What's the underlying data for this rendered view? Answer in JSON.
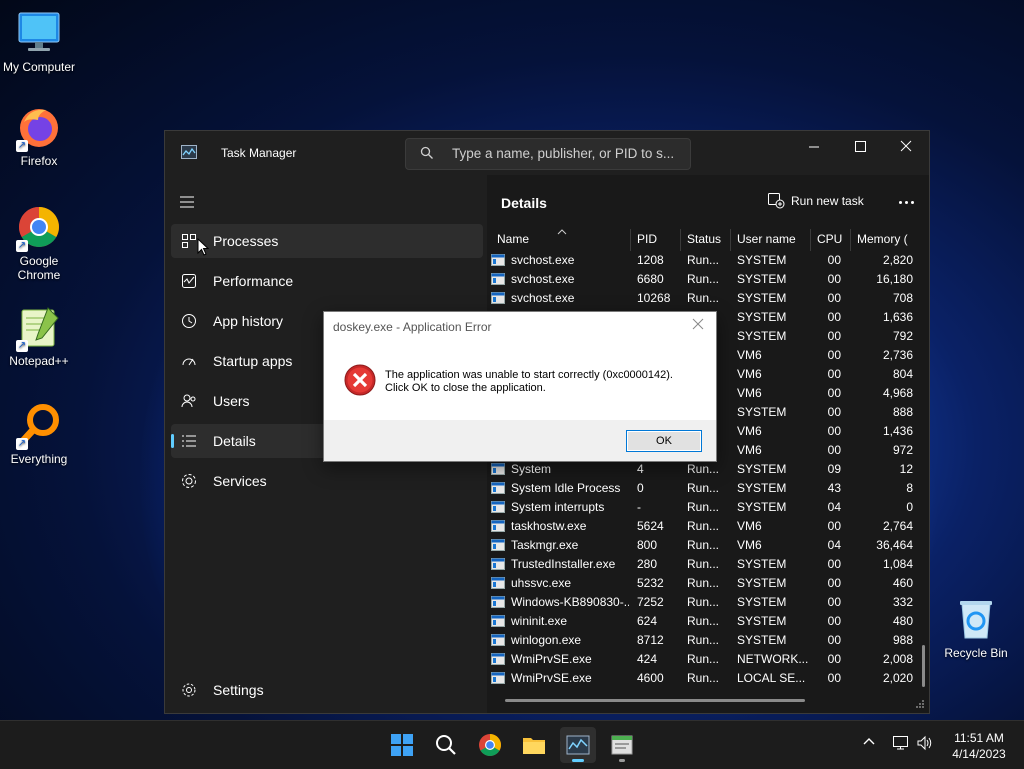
{
  "desktop": {
    "icons": [
      {
        "label": "My Computer"
      },
      {
        "label": "Firefox"
      },
      {
        "label": "Google Chrome"
      },
      {
        "label": "Notepad++"
      },
      {
        "label": "Everything"
      },
      {
        "label": "Recycle Bin"
      }
    ]
  },
  "task_manager": {
    "title": "Task Manager",
    "search_placeholder": "Type a name, publisher, or PID to s...",
    "nav": [
      {
        "label": "Processes",
        "icon": "processes-icon"
      },
      {
        "label": "Performance",
        "icon": "performance-icon"
      },
      {
        "label": "App history",
        "icon": "app-history-icon"
      },
      {
        "label": "Startup apps",
        "icon": "startup-apps-icon"
      },
      {
        "label": "Users",
        "icon": "users-icon"
      },
      {
        "label": "Details",
        "icon": "details-icon",
        "selected": true
      },
      {
        "label": "Services",
        "icon": "services-icon"
      }
    ],
    "settings_label": "Settings",
    "details": {
      "heading": "Details",
      "run_new_task": "Run new task",
      "columns": [
        "Name",
        "PID",
        "Status",
        "User name",
        "CPU",
        "Memory ("
      ],
      "rows": [
        [
          "svchost.exe",
          "1208",
          "Run...",
          "SYSTEM",
          "00",
          "2,820"
        ],
        [
          "svchost.exe",
          "6680",
          "Run...",
          "SYSTEM",
          "00",
          "16,180"
        ],
        [
          "svchost.exe",
          "10268",
          "Run...",
          "SYSTEM",
          "00",
          "708"
        ],
        [
          "",
          "",
          "",
          "SYSTEM",
          "00",
          "1,636"
        ],
        [
          "",
          "",
          "",
          "SYSTEM",
          "00",
          "792"
        ],
        [
          "",
          "",
          "",
          "VM6",
          "00",
          "2,736"
        ],
        [
          "",
          "",
          "",
          "VM6",
          "00",
          "804"
        ],
        [
          "",
          "",
          "",
          "VM6",
          "00",
          "4,968"
        ],
        [
          "",
          "",
          "",
          "SYSTEM",
          "00",
          "888"
        ],
        [
          "",
          "",
          "",
          "VM6",
          "00",
          "1,436"
        ],
        [
          "",
          "",
          "",
          "VM6",
          "00",
          "972"
        ],
        [
          "System",
          "4",
          "Run...",
          "SYSTEM",
          "09",
          "12"
        ],
        [
          "System Idle Process",
          "0",
          "Run...",
          "SYSTEM",
          "43",
          "8"
        ],
        [
          "System interrupts",
          "-",
          "Run...",
          "SYSTEM",
          "04",
          "0"
        ],
        [
          "taskhostw.exe",
          "5624",
          "Run...",
          "VM6",
          "00",
          "2,764"
        ],
        [
          "Taskmgr.exe",
          "800",
          "Run...",
          "VM6",
          "04",
          "36,464"
        ],
        [
          "TrustedInstaller.exe",
          "280",
          "Run...",
          "SYSTEM",
          "00",
          "1,084"
        ],
        [
          "uhssvc.exe",
          "5232",
          "Run...",
          "SYSTEM",
          "00",
          "460"
        ],
        [
          "Windows-KB890830-...",
          "7252",
          "Run...",
          "SYSTEM",
          "00",
          "332"
        ],
        [
          "wininit.exe",
          "624",
          "Run...",
          "SYSTEM",
          "00",
          "480"
        ],
        [
          "winlogon.exe",
          "8712",
          "Run...",
          "SYSTEM",
          "00",
          "988"
        ],
        [
          "WmiPrvSE.exe",
          "424",
          "Run...",
          "NETWORK...",
          "00",
          "2,008"
        ],
        [
          "WmiPrvSE.exe",
          "4600",
          "Run...",
          "LOCAL SE...",
          "00",
          "2,020"
        ]
      ]
    }
  },
  "error_dialog": {
    "title": "doskey.exe - Application Error",
    "message_line1": "The application was unable to start correctly (0xc0000142).",
    "message_line2": "Click OK to close the application.",
    "ok_label": "OK"
  },
  "taskbar": {
    "time": "11:51 AM",
    "date": "4/14/2023"
  },
  "colors": {
    "accent": "#60cdff",
    "window_bg": "#1f1f1f",
    "error_red": "#d32f2f"
  }
}
